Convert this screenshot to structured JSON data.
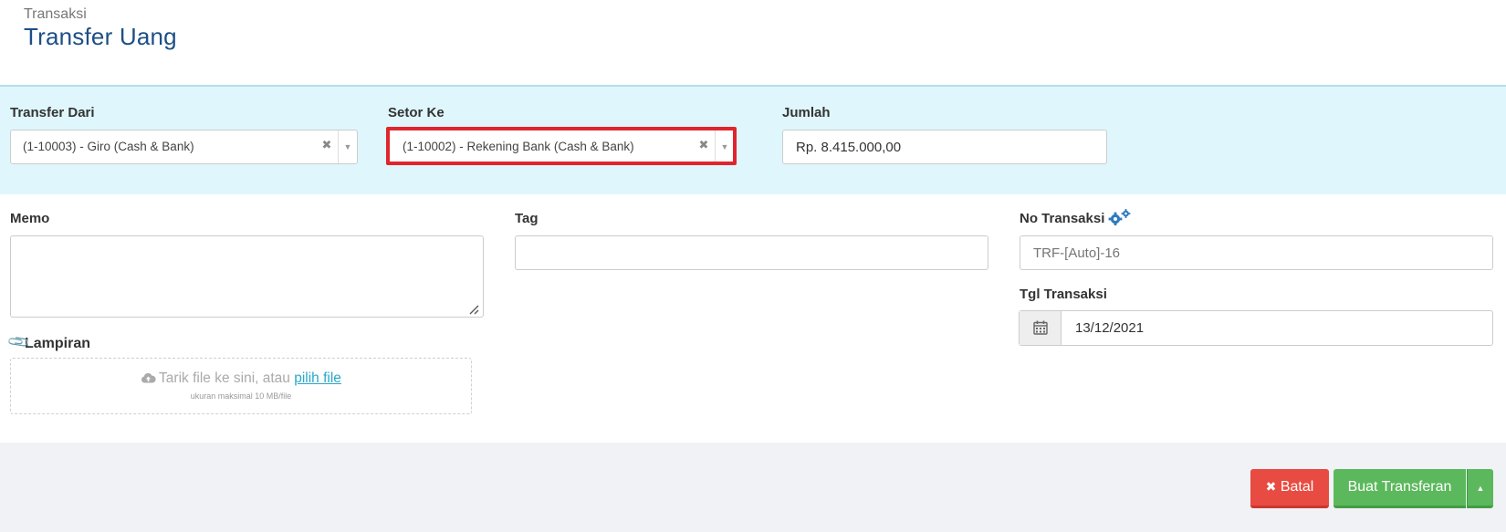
{
  "header": {
    "breadcrumb": "Transaksi",
    "title": "Transfer Uang"
  },
  "transfer": {
    "from_label": "Transfer Dari",
    "from_value": "(1-10003) - Giro (Cash & Bank)",
    "to_label": "Setor Ke",
    "to_value": "(1-10002) - Rekening Bank (Cash & Bank)",
    "amount_label": "Jumlah",
    "amount_value": "Rp. 8.415.000,00"
  },
  "details": {
    "memo_label": "Memo",
    "memo_value": "",
    "tag_label": "Tag",
    "tag_value": "",
    "trx_no_label": "No Transaksi",
    "trx_no_placeholder": "TRF-[Auto]-16",
    "trx_date_label": "Tgl Transaksi",
    "trx_date_value": "13/12/2021"
  },
  "attachment": {
    "label": "Lampiran",
    "drop_text": "Tarik file ke sini, atau",
    "choose_link": "pilih file",
    "hint": "ukuran maksimal 10 MB/file"
  },
  "actions": {
    "cancel_label": "Batal",
    "create_label": "Buat Transferan"
  },
  "colors": {
    "title_blue": "#1d4f86",
    "panel_bg": "#dff6fd",
    "highlight_red": "#e0252d",
    "cancel_red": "#e84b41",
    "create_green": "#5cb85c",
    "link_blue": "#2aa7c9"
  },
  "icons": {
    "clear": "times-icon",
    "dropdown": "caret-down-icon",
    "settings": "gears-icon",
    "calendar": "calendar-icon",
    "attachment": "paperclip-icon",
    "upload": "cloud-upload-icon",
    "cancel": "times-icon",
    "menu": "caret-up-icon"
  }
}
